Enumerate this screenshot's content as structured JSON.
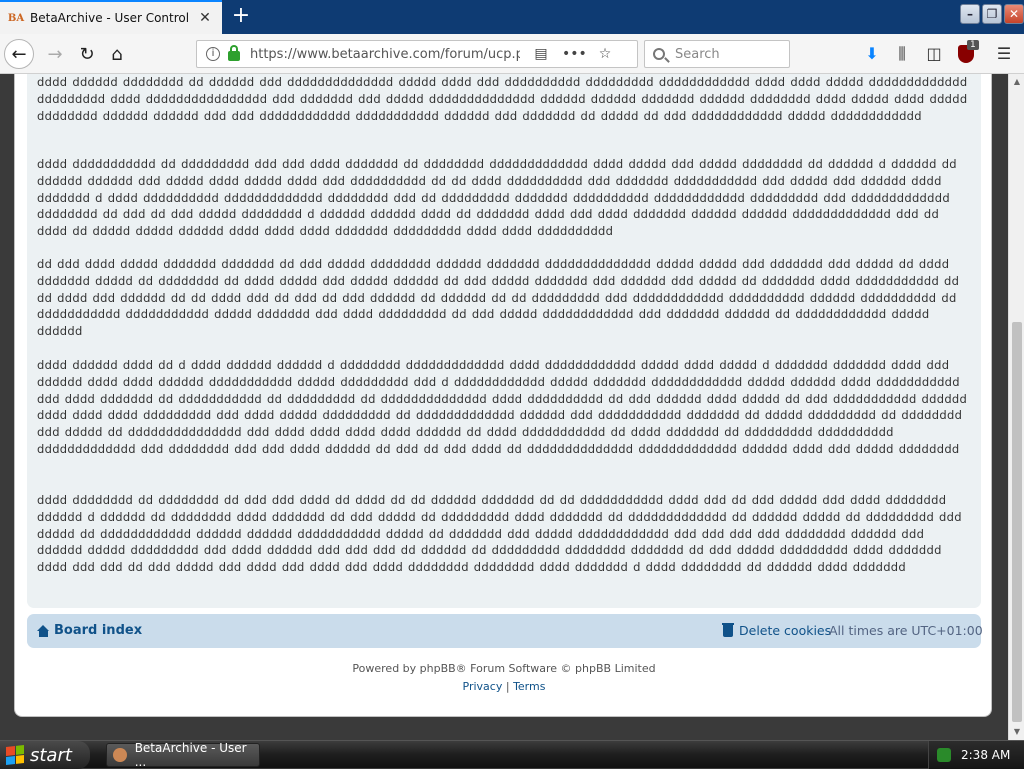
{
  "browser": {
    "tab_title": "BetaArchive - User Control Panel",
    "tab_favicon_text": "BA",
    "url": "https://www.betaarchive.com/forum/ucp.p",
    "search_placeholder": "Search",
    "ublock_badge": "1"
  },
  "post": {
    "paragraphs": [
      "dddd dddddd dddddddd dd dddddd ddd dddddddddddddd ddddd dddd ddd dddddddddd ddddddddd dddddddddddd dddd dddd ddddd ddddddddddddd ddddddddd dddd dddddddddddddddd ddd ddddddd   ddd ddddd dddddddddddddd dddddd dddddd ddddddd dddddd dddddddd dddd ddddd dddd ddddd dddddddd dddddd dddddd   ddd ddd dddddddddddd ddddddddddd dddddd ddd ddddddd dd ddddd dd ddd dddddddddddd ddddd dddddddddddd  ",
      "dddd ddddddddddd dd ddddddddd ddd ddd dddd ddddddd dd dddddddd ddddddddddddd dddd ddddd ddd ddddd dddddddd dd dddddd d dddddd dd dddddd dddddd ddd ddddd dddd ddddd dddd ddd dddddddddd dd dd dddd dddddddddd ddd ddddddd ddddddddddd ddd ddddd ddd dddddd dddd ddddddd d dddd dddddddddd ddddddddddddd dddddddd ddd dd ddddddddd ddddddd dddddddddd dddddddddddd ddddddddd ddd   ddddddddddddd dddddddd dd ddd dd ddd ddddd dddddddd d dddddd dddddd dddd dd ddddddd dddd ddd dddd ddddddd dddddd dddddd ddddddddddddd ddd dd dddd dd ddddd ddddd dddddd dddd dddd dddd ddddddd ddddddddd dddd dddd dddddddddd",
      "dd ddd dddd ddddd ddddddd ddddddd dd ddd ddddd dddddddd dddddd ddddddd dddddddddddddd ddddd ddddd ddd ddddddd ddd ddddd dd dddd ddddddd ddddd dd dddddddd dd dddd ddddd ddd ddddd dddddd dd ddd ddddd ddddddd ddd dddddd ddd ddddd dd ddddddd dddd ddddddddddd dd dd dddd ddd dddddd dd dd dddd ddd dd ddd dd ddd dddddd dd dddddd dd dd ddddddddd ddd dddddddddddd dddddddddd dddddd   dddddddddd dd ddddddddddd ddddddddddd ddddd ddddddd   ddd dddd ddddddddd dd ddd ddddd dddddddddddd ddd ddddddd dddddd dd dddddddddddd ddddd dddddd  ",
      "dddd dddddd dddd dd d dddd dddddd dddddd d dddddddd ddddddddddddd dddd dddddddddddd ddddd dddd ddddd   d ddddddd ddddddd dddd ddd dddddd dddd dddd dddddd ddddddddddd ddddd ddddddddd   ddd d dddddddddddd ddddd ddddddd dddddddddddd ddddd dddddd   dddd ddddddddddd ddd dddd ddddddd dd ddddddddddd dd ddddddddd dd dddddddddddddd dddd dddddddddd dd ddd dddddd dddd ddddd dd ddd ddddddddddd dddddd dddd dddd dddd ddddddddd ddd dddd ddddd ddddddddd dd ddddddddddddd dddddd ddd ddddddddddd ddddddd dd ddddd ddddddddd dd dddddddd ddd ddddd dd ddddddddddddddd ddd dddd dddd dddd dddd dddddd dd dddd ddddddddddd dd dddd ddddddd dd ddddddddd dddddddddd ddddddddddddd ddd dddddddd ddd ddd dddd dddddd dd ddd dd ddd dddd dd dddddddddddddd ddddddddddddd dddddd dddd ddd ddddd dddddddd",
      "dddd dddddddd dd dddddddd dd ddd ddd dddd   dd dddd dd dd dddddd ddddddd dd dd ddddddddddd dddd ddd dd ddd ddddd ddd dddd dddddddd dddddd d dddddd dd dddddddd dddd ddddddd dd ddd ddddd dd ddddddddd dddd ddddddd dd ddddddddddddd dd dddddd ddddd dd ddddddddd ddd ddddd dd dddddddddddd dddddd dddddd ddddddddddd ddddd dd ddddddd ddd ddddd dddddddddddd ddd ddd ddd ddd dddddddd dddddd ddd dddddd ddddd ddddddddd ddd dddd dddddd ddd ddd ddd dd dddddd dd ddddddddd dddddddd ddddddd dd ddd ddddd ddddddddd dddd ddddddd dddd ddd ddd dd ddd ddddd ddd dddd ddd dddd ddd dddd dddddddd dddddddd dddd ddddddd d dddd dddddddd dd dddddd dddd ddddddd"
    ]
  },
  "board_nav": {
    "board_index": "Board index",
    "delete_cookies": "Delete cookies",
    "all_times": "All times are UTC+01:00"
  },
  "footer": {
    "powered_by": "Powered by phpBB® Forum Software © phpBB Limited",
    "privacy": "Privacy",
    "separator": "|",
    "terms": "Terms"
  },
  "taskbar": {
    "start_label": "start",
    "task_label": "BetaArchive - User ...",
    "clock": "2:38 AM"
  },
  "icons": [
    "back-icon",
    "forward-icon",
    "reload-icon",
    "home-icon",
    "info-icon",
    "lock-icon",
    "reader-icon",
    "more-icon",
    "bookmark-star-icon",
    "search-icon",
    "download-icon",
    "library-icon",
    "sidebar-icon",
    "ublock-icon",
    "menu-icon",
    "trash-icon"
  ]
}
